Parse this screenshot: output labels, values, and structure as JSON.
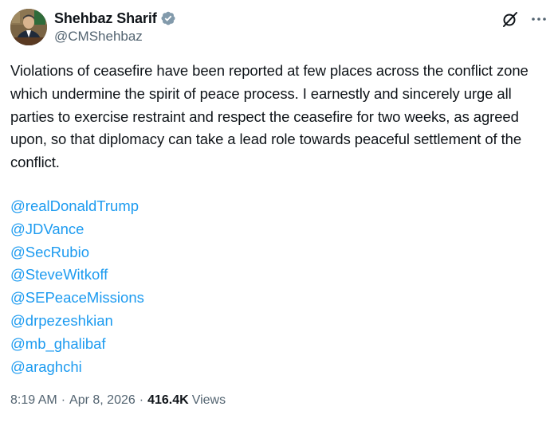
{
  "author": {
    "display_name": "Shehbaz Sharif",
    "handle": "@CMShehbaz",
    "verified": true
  },
  "post": {
    "text": "Violations of ceasefire have been reported at few places across the conflict zone which undermine the spirit of peace process. I earnestly and sincerely urge all parties to exercise restraint and respect the ceasefire for two weeks, as agreed upon, so that diplomacy can take a lead role towards peaceful settlement of the conflict.",
    "mentions": [
      "@realDonaldTrump",
      "@JDVance",
      "@SecRubio",
      "@SteveWitkoff",
      "@SEPeaceMissions",
      "@drpezeshkian",
      "@mb_ghalibaf",
      "@araghchi"
    ]
  },
  "meta": {
    "time": "8:19 AM",
    "separator": "·",
    "date": "Apr 8, 2026",
    "views_count": "416.4K",
    "views_label": "Views"
  },
  "colors": {
    "link": "#1d9bf0",
    "text": "#0f1419",
    "secondary": "#536471",
    "verified_badge": "#829aab"
  },
  "icons": {
    "verified": "verified-badge-icon",
    "grok": "grok-icon",
    "more": "more-options-icon"
  }
}
